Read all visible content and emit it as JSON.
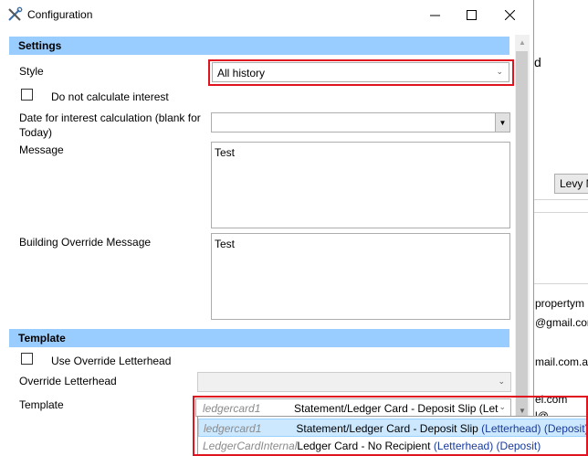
{
  "window": {
    "title": "Configuration"
  },
  "background": {
    "levy_button": "Levy N",
    "texts": [
      "propertym",
      "@gmail.cor",
      "mail.com.a",
      "el.com",
      "l@"
    ],
    "mark": "d"
  },
  "settings": {
    "header": "Settings",
    "style_label": "Style",
    "style_value": "All history",
    "no_interest_label": "Do not calculate interest",
    "date_label": "Date for interest calculation (blank for Today)",
    "message_label": "Message",
    "message_value": "Test",
    "building_label": "Building Override Message",
    "building_value": "Test"
  },
  "template": {
    "header": "Template",
    "use_override_label": "Use Override Letterhead",
    "override_label": "Override Letterhead",
    "template_label": "Template",
    "selected_code": "ledgercard1",
    "selected_name": "Statement/Ledger Card - Deposit Slip (Let",
    "options": [
      {
        "code": "ledgercard1",
        "name": "Statement/Ledger Card - Deposit Slip",
        "letterhead": "(Letterhead)",
        "deposit": "(Deposit)"
      },
      {
        "code": "LedgerCardInternal",
        "name": "Ledger Card - No Recipient",
        "letterhead": "(Letterhead)",
        "deposit": "(Deposit)"
      }
    ]
  },
  "colors": {
    "section_header": "#99ccff",
    "highlight": "#e0141e",
    "selection": "#cce8ff"
  }
}
